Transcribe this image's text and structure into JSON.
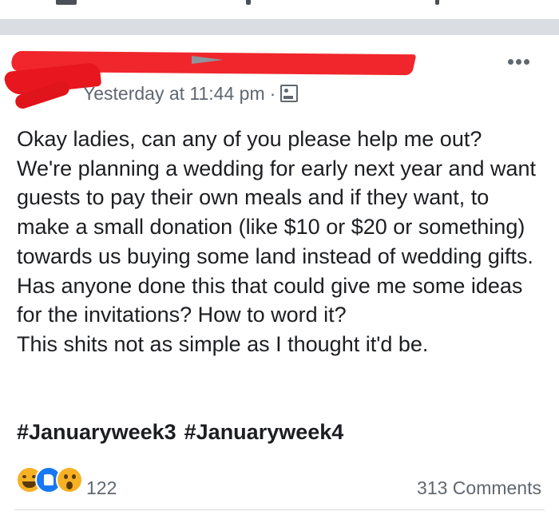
{
  "post": {
    "timestamp": "Yesterday at 11:44 pm",
    "separator": "·",
    "audience_icon": "friends-icon",
    "more_icon": "more-options-icon",
    "redaction_color": "#f0262c",
    "body": [
      "Okay ladies, can any of you please help me out?",
      "We're planning a wedding for early next year and want guests to pay their own meals and if they want, to make a small donation (like $10 or $20 or something) towards us buying some land instead of wedding gifts.",
      "Has anyone done this that could give me some ideas for the invitations? How to word it?",
      "This shits not as simple as I thought it'd be."
    ],
    "hashtags": [
      "#Januaryweek3",
      "#Januaryweek4"
    ]
  },
  "footer": {
    "reaction_icons": [
      "haha-icon",
      "like-icon",
      "wow-icon"
    ],
    "reaction_count": "122",
    "comments": "313 Comments"
  }
}
